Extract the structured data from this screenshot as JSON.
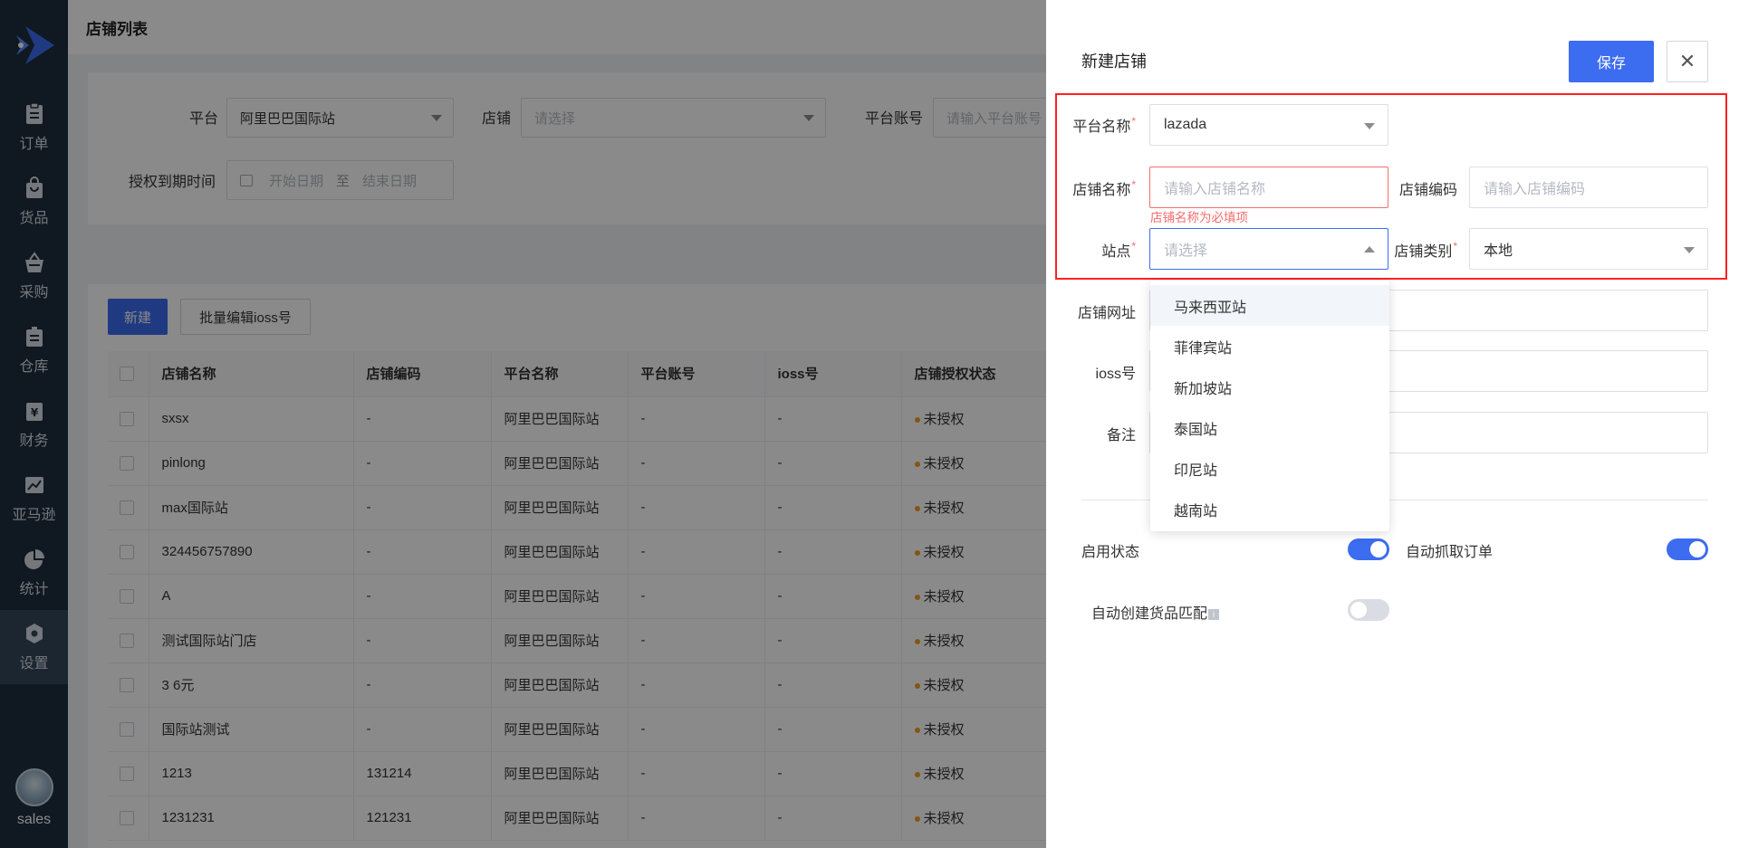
{
  "sidebar": {
    "items": [
      {
        "label": "订单",
        "icon": "order-icon"
      },
      {
        "label": "货品",
        "icon": "goods-icon"
      },
      {
        "label": "采购",
        "icon": "purchase-icon"
      },
      {
        "label": "仓库",
        "icon": "warehouse-icon"
      },
      {
        "label": "财务",
        "icon": "finance-icon"
      },
      {
        "label": "亚马逊",
        "icon": "amazon-icon"
      },
      {
        "label": "统计",
        "icon": "stats-icon"
      },
      {
        "label": "设置",
        "icon": "settings-icon"
      }
    ],
    "user": "sales"
  },
  "page": {
    "title": "店铺列表"
  },
  "filters": {
    "platform_label": "平台",
    "platform_value": "阿里巴巴国际站",
    "shop_label": "店铺",
    "shop_placeholder": "请选择",
    "account_label": "平台账号",
    "account_placeholder": "请输入平台账号",
    "expire_label": "授权到期时间",
    "start_placeholder": "开始日期",
    "range_sep": "至",
    "end_placeholder": "结束日期"
  },
  "toolbar": {
    "new_label": "新建",
    "batch_label": "批量编辑ioss号"
  },
  "table": {
    "headers": [
      "店铺名称",
      "店铺编码",
      "平台名称",
      "平台账号",
      "ioss号",
      "店铺授权状态"
    ],
    "rows": [
      [
        "sxsx",
        "-",
        "阿里巴巴国际站",
        "-",
        "-",
        "未授权"
      ],
      [
        "pinlong",
        "-",
        "阿里巴巴国际站",
        "-",
        "-",
        "未授权"
      ],
      [
        "max国际站",
        "-",
        "阿里巴巴国际站",
        "-",
        "-",
        "未授权"
      ],
      [
        "324456757890",
        "-",
        "阿里巴巴国际站",
        "-",
        "-",
        "未授权"
      ],
      [
        "A",
        "-",
        "阿里巴巴国际站",
        "-",
        "-",
        "未授权"
      ],
      [
        "测试国际站门店",
        "-",
        "阿里巴巴国际站",
        "-",
        "-",
        "未授权"
      ],
      [
        "3 6元",
        "-",
        "阿里巴巴国际站",
        "-",
        "-",
        "未授权"
      ],
      [
        "国际站测试",
        "-",
        "阿里巴巴国际站",
        "-",
        "-",
        "未授权"
      ],
      [
        "1213",
        "131214",
        "阿里巴巴国际站",
        "-",
        "-",
        "未授权"
      ],
      [
        "1231231",
        "121231",
        "阿里巴巴国际站",
        "-",
        "-",
        "未授权"
      ]
    ]
  },
  "drawer": {
    "title": "新建店铺",
    "save_label": "保存",
    "close_glyph": "✕",
    "platform_label": "平台名称",
    "platform_value": "lazada",
    "shop_name_label": "店铺名称",
    "shop_name_placeholder": "请输入店铺名称",
    "shop_name_error": "店铺名称为必填项",
    "shop_code_label": "店铺编码",
    "shop_code_placeholder": "请输入店铺编码",
    "site_label": "站点",
    "site_placeholder": "请选择",
    "category_label": "店铺类别",
    "category_value": "本地",
    "url_label": "店铺网址",
    "ioss_label": "ioss号",
    "remark_label": "备注",
    "enable_label": "启用状态",
    "auto_fetch_label": "自动抓取订单",
    "auto_match_label": "自动创建货品匹配",
    "enable_on": true,
    "auto_fetch_on": true,
    "auto_match_on": false,
    "required_mark": "*",
    "info_glyph": "i"
  },
  "site_options": [
    "马来西亚站",
    "菲律宾站",
    "新加坡站",
    "泰国站",
    "印尼站",
    "越南站"
  ],
  "colors": {
    "primary": "#3c6cf0",
    "error": "#f56c6c",
    "highlight_frame": "#ff2020",
    "sidebar": "#1f2d3d"
  }
}
